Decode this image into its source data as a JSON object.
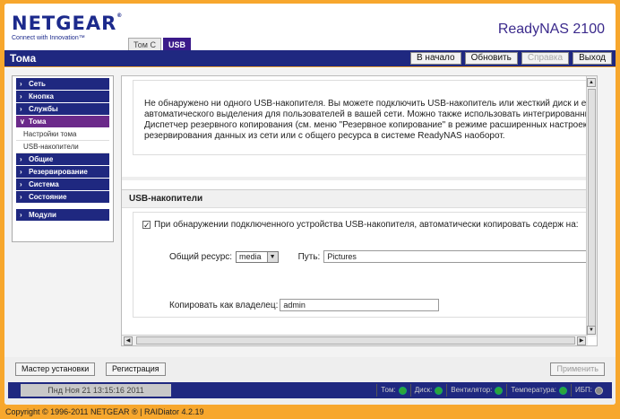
{
  "header": {
    "logo": "NETGEAR",
    "tagline": "Connect with Innovation™",
    "tabs": [
      "Том C",
      "USB"
    ],
    "product": "ReadyNAS 2100"
  },
  "titlebar": {
    "title": "Тома",
    "buttons": [
      "В начало",
      "Обновить",
      "Справка",
      "Выход"
    ]
  },
  "sidebar": {
    "items": [
      "Сеть",
      "Кнопка",
      "Службы",
      "Тома"
    ],
    "subitems": [
      "Настройки тома",
      "USB-накопители"
    ],
    "items2": [
      "Общие",
      "Резервирование",
      "Система",
      "Состояние"
    ],
    "modules": "Модули"
  },
  "content": {
    "info_text": "Не обнаружено ни одного USB-накопителя. Вы можете подключить USB-накопитель или жесткий диск и его автоматического выделения для пользователей в вашей сети. Можно также использовать интегрированный Диспетчер резервного копирования (см. меню \"Резервное копирование\" в режиме расширенных настроек) для резервирования данных из сети или с общего ресурса в системе ReadyNAS наоборот.",
    "section_title": "USB-накопители",
    "checkbox_label": "При обнаружении подключенного устройства USB-накопителя, автоматически копировать содерж на:",
    "share_label": "Общий ресурс:",
    "share_value": "media",
    "path_label": "Путь:",
    "path_value": "Pictures",
    "owner_label": "Копировать как владелец:",
    "owner_value": "admin"
  },
  "bottom": {
    "wizard": "Мастер установки",
    "register": "Регистрация",
    "apply": "Применить",
    "datetime": "Пнд Ноя 21  13:15:16 2011",
    "status_labels": [
      "Том:",
      "Диск:",
      "Вентилятор:",
      "Температура:",
      "ИБП:"
    ]
  },
  "footer": "Copyright © 1996-2011 NETGEAR ® | RAIDiator 4.2.19"
}
